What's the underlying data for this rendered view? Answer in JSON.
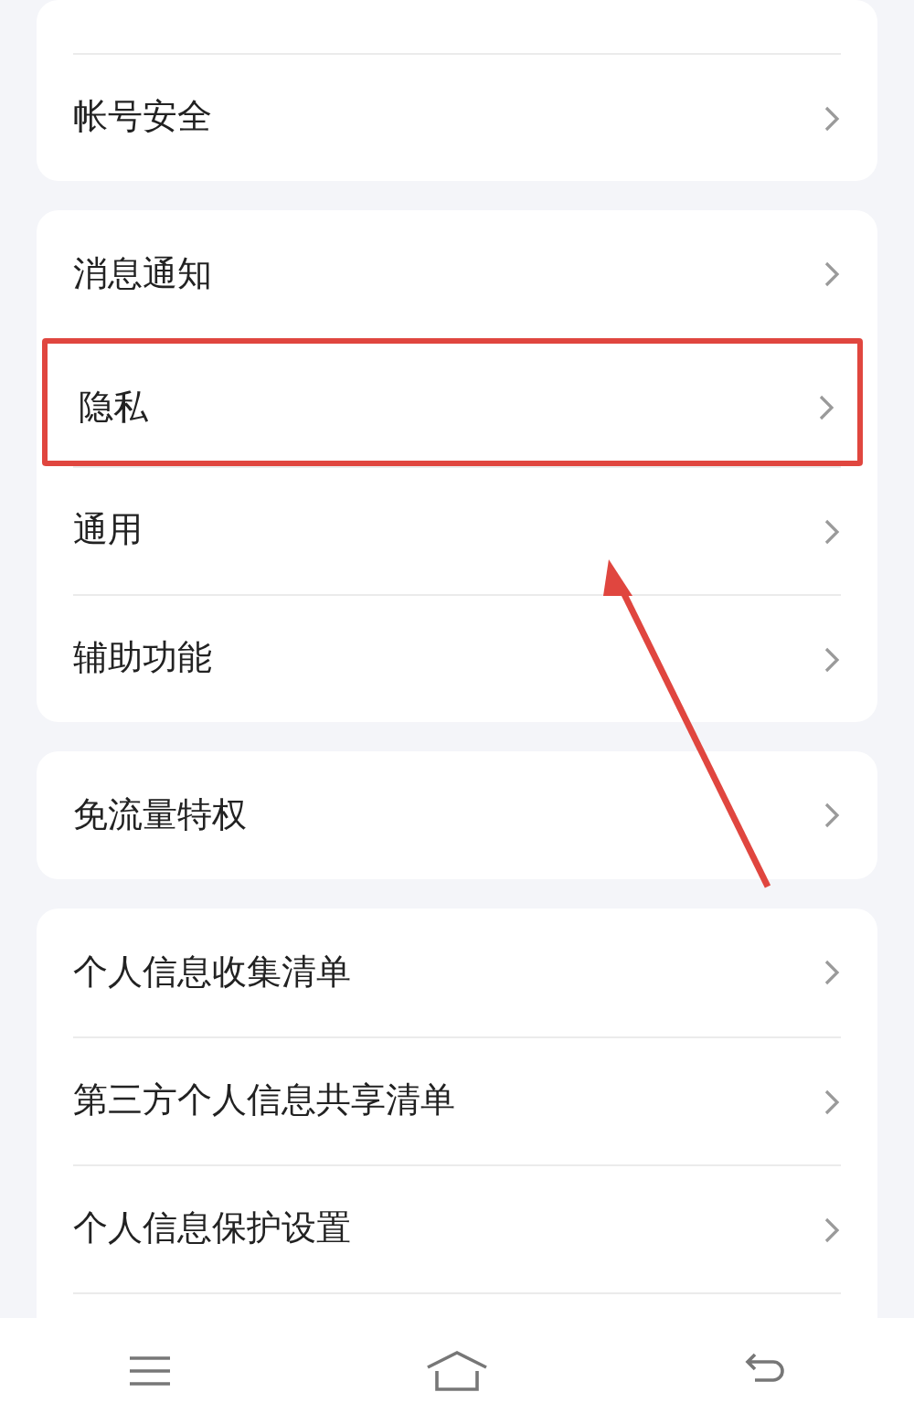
{
  "groups": [
    {
      "items": [
        {
          "label": "帐号安全",
          "highlighted": false
        }
      ]
    },
    {
      "items": [
        {
          "label": "消息通知",
          "highlighted": false
        },
        {
          "label": "隐私",
          "highlighted": true
        },
        {
          "label": "通用",
          "highlighted": false
        },
        {
          "label": "辅助功能",
          "highlighted": false
        }
      ]
    },
    {
      "items": [
        {
          "label": "免流量特权",
          "highlighted": false
        }
      ]
    },
    {
      "items": [
        {
          "label": "个人信息收集清单",
          "highlighted": false
        },
        {
          "label": "第三方个人信息共享清单",
          "highlighted": false
        },
        {
          "label": "个人信息保护设置",
          "highlighted": false
        }
      ]
    }
  ],
  "nav_bar": [
    {
      "kind": "menu"
    },
    {
      "kind": "home"
    },
    {
      "kind": "back"
    }
  ]
}
